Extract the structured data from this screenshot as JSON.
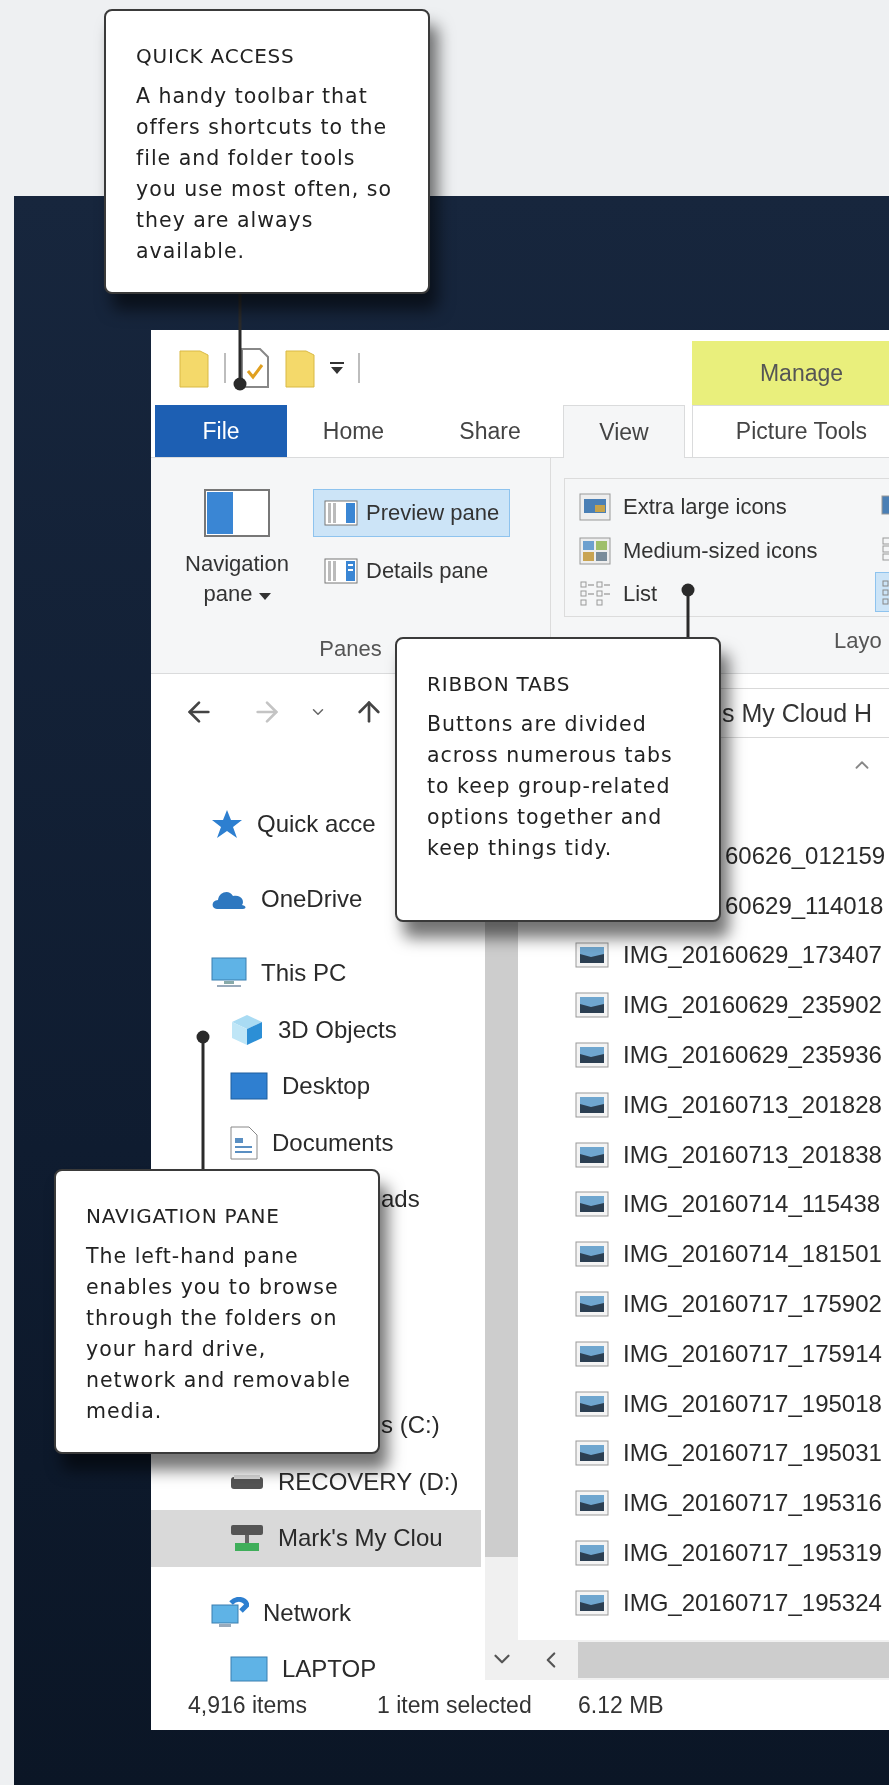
{
  "callouts": [
    {
      "title": "QUICK ACCESS",
      "text": "A handy toolbar that offers shortcuts to the file and folder tools you use most often, so they are always available."
    },
    {
      "title": "RIBBON TABS",
      "text": "Buttons are divided across numerous tabs to keep group-related options together and keep things tidy."
    },
    {
      "title": "NAVIGATION PANE",
      "text": "The left-hand pane enables you to browse through the folders on your hard drive, network and removable media."
    }
  ],
  "window": {
    "context_tab": "Manage",
    "tabs": [
      {
        "label": "File",
        "kind": "file",
        "selected": false
      },
      {
        "label": "Home",
        "kind": "plain",
        "selected": false
      },
      {
        "label": "Share",
        "kind": "plain",
        "selected": false
      },
      {
        "label": "View",
        "kind": "plain",
        "selected": true
      },
      {
        "label": "Picture Tools",
        "kind": "contextual",
        "selected": false
      }
    ],
    "ribbon": {
      "panes": {
        "navigation_pane": "Navigation pane",
        "preview_pane": {
          "label": "Preview pane",
          "selected": true
        },
        "details_pane": {
          "label": "Details pane",
          "selected": false
        },
        "label": "Panes"
      },
      "layout": {
        "options": [
          {
            "label": "Extra large icons",
            "selected": false
          },
          {
            "label": "Medium-sized icons",
            "selected": false
          },
          {
            "label": "List",
            "selected": false
          }
        ],
        "more_options": [
          {
            "selected": false
          },
          {
            "selected": false
          },
          {
            "selected": true
          }
        ],
        "label": "Layo"
      }
    },
    "address": "s My Cloud H",
    "sidebar": {
      "items": [
        {
          "label": "Quick acce",
          "kind": "star",
          "selected": false
        },
        {
          "label": "OneDrive",
          "kind": "cloud",
          "selected": false
        },
        {
          "label": "This PC",
          "kind": "pc",
          "selected": false,
          "children": [
            {
              "label": "3D Objects",
              "kind": "cube",
              "selected": false
            },
            {
              "label": "Desktop",
              "kind": "desktop",
              "selected": false
            },
            {
              "label": "Documents",
              "kind": "document",
              "selected": false
            },
            {
              "label": "ads",
              "kind": "clipped",
              "selected": false
            },
            {
              "label": "s (C:)",
              "kind": "clipped",
              "selected": false
            },
            {
              "label": "RECOVERY (D:)",
              "kind": "drive",
              "selected": false
            },
            {
              "label": "Mark's My Clou",
              "kind": "netdrive",
              "selected": true
            }
          ]
        },
        {
          "label": "Network",
          "kind": "network",
          "selected": false,
          "children": [
            {
              "label": "LAPTOP",
              "kind": "laptop",
              "selected": false
            }
          ]
        }
      ]
    },
    "files": [
      {
        "name": "60626_012159",
        "kind": "clipped"
      },
      {
        "name": "60629_114018",
        "kind": "clipped"
      },
      {
        "name": "IMG_20160629_173407",
        "kind": "image"
      },
      {
        "name": "IMG_20160629_235902",
        "kind": "image"
      },
      {
        "name": "IMG_20160629_235936",
        "kind": "image"
      },
      {
        "name": "IMG_20160713_201828",
        "kind": "image"
      },
      {
        "name": "IMG_20160713_201838",
        "kind": "image"
      },
      {
        "name": "IMG_20160714_115438",
        "kind": "image"
      },
      {
        "name": "IMG_20160714_181501",
        "kind": "image"
      },
      {
        "name": "IMG_20160717_175902",
        "kind": "image"
      },
      {
        "name": "IMG_20160717_175914",
        "kind": "image"
      },
      {
        "name": "IMG_20160717_195018",
        "kind": "image"
      },
      {
        "name": "IMG_20160717_195031",
        "kind": "image"
      },
      {
        "name": "IMG_20160717_195316",
        "kind": "image"
      },
      {
        "name": "IMG_20160717_195319",
        "kind": "image"
      },
      {
        "name": "IMG_20160717_195324",
        "kind": "image"
      }
    ],
    "status_bar": {
      "count": "4,916 items",
      "selection": "1 item selected",
      "size": "6.12 MB"
    }
  }
}
